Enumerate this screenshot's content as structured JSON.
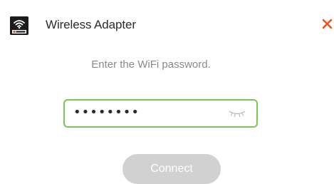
{
  "window": {
    "title": "Wireless Adapter",
    "icon": "wifi-adapter-icon",
    "close_icon": "close-icon",
    "accent_color": "#e8531e"
  },
  "form": {
    "prompt": "Enter the WiFi password.",
    "password_masked": "••••••••",
    "field_border_color": "#7ac74f",
    "eye_icon": "eye-closed-icon"
  },
  "actions": {
    "connect_label": "Connect",
    "connect_enabled": false
  }
}
